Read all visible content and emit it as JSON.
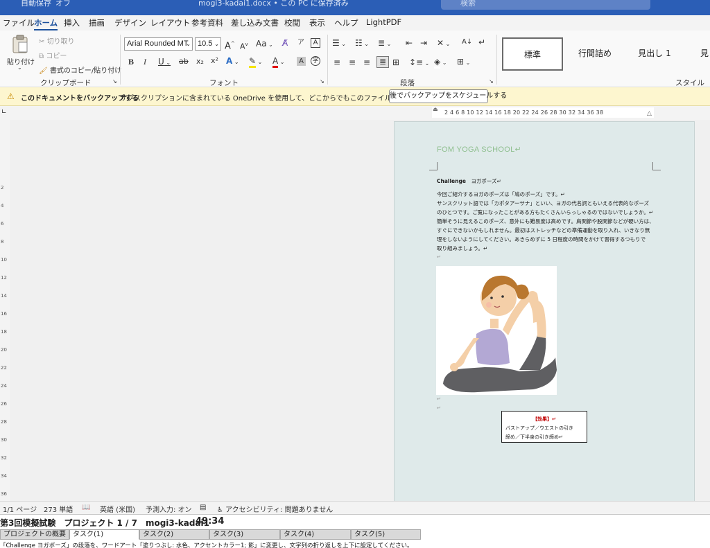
{
  "titlebar": {
    "autosave": "自動保存",
    "autosave_state": "オフ",
    "doc_title": "mogi3-kadai1.docx • この PC に保存済み",
    "search_placeholder": "検索"
  },
  "menu": {
    "tabs": [
      "ファイル",
      "ホーム",
      "挿入",
      "描画",
      "デザイン",
      "レイアウト",
      "参考資料",
      "差し込み文書",
      "校閲",
      "表示",
      "ヘルプ",
      "LightPDF"
    ],
    "active": "ホーム"
  },
  "ribbon": {
    "clipboard": {
      "paste": "貼り付け",
      "cut": "切り取り",
      "copy": "コピー",
      "format_painter": "書式のコピー/貼り付け",
      "label": "クリップボード"
    },
    "font": {
      "font_name": "Arial Rounded MT",
      "font_size": "10.5",
      "label": "フォント",
      "grow": "A",
      "shrink": "A",
      "case": "Aa",
      "bold": "B",
      "italic": "I",
      "underline": "U",
      "strike": "ab",
      "subscript": "x₂",
      "superscript": "x²"
    },
    "paragraph": {
      "label": "段落"
    },
    "styles": {
      "items": [
        "標準",
        "行間詰め",
        "見出し 1",
        "見"
      ],
      "label": "スタイル"
    }
  },
  "notification": {
    "bold_text": "このドキュメントをバックアップする",
    "message": "サブスクリプションに含まれている OneDrive を使用して、どこからでもこのファイルにアクセスできます。",
    "button": "後でバックアップをスケジュールする"
  },
  "ruler": {
    "ticks": "2   4   6   8  10  12  14  16  18  20  22  24  26  28  30  32  34  36  38",
    "vertical_numbers": [
      "2",
      "4",
      "6",
      "8",
      "10",
      "12",
      "14",
      "16",
      "18",
      "20",
      "22",
      "24",
      "26",
      "28",
      "30",
      "32",
      "34",
      "36"
    ]
  },
  "document": {
    "heading": "FOM YOGA SCHOOL↵",
    "challenge_label": "Challenge",
    "challenge_title": "ヨガポーズ↵",
    "body_lines": [
      "今回ご紹介するヨガのポーズは「鳩のポーズ」です。↵",
      "サンスクリット語では「カポタアーサナ」といい、ヨガの代名詞ともいえる代表的なポーズ",
      "のひとつです。ご覧になったことがある方もたくさんいらっしゃるのではないでしょうか。↵",
      "簡単そうに見えるこのポーズ、意外にも難易度は高めです。肩関節や股関節などが硬い方は、",
      "すぐにできないかもしれません。最初はストレッチなどの準備運動を取り入れ、いきなり無",
      "理をしないようにしてください。あきらめずに 5 日程度の時間をかけて習得するつもりで",
      "取り組みましょう。↵"
    ],
    "para_mark": "↵",
    "effect": {
      "title": "【効果】↵",
      "line1": "バストアップ／ウエストの引き",
      "line2": "締め／下半身の引き締め↵"
    }
  },
  "statusbar": {
    "page": "1/1 ページ",
    "words": "273 単語",
    "language": "英語 (米国)",
    "predict": "予測入力: オン",
    "accessibility": "アクセシビリティ: 問題ありません"
  },
  "exam": {
    "title": "第3回模擬試験　プロジェクト 1 / 7　mogi3-kadai1",
    "timer": "49:34",
    "tabs": [
      "プロジェクトの概要",
      "タスク(1)",
      "タスク(2)",
      "タスク(3)",
      "タスク(4)",
      "タスク(5)"
    ],
    "active_tab": "タスク(1)",
    "instruction": "「Challenge ヨガポーズ」の段落を、ワードアート「塗りつぶし: 水色、アクセントカラー1; 影」に変更し、文字列の折り返しを上下に設定してください。"
  },
  "colors": {
    "titlebar": "#2b5eb6",
    "page_background": "#dfeaea",
    "heading_green": "#8fbf8f",
    "notify_bg": "#fdf6cf",
    "effect_red": "#c00000"
  }
}
